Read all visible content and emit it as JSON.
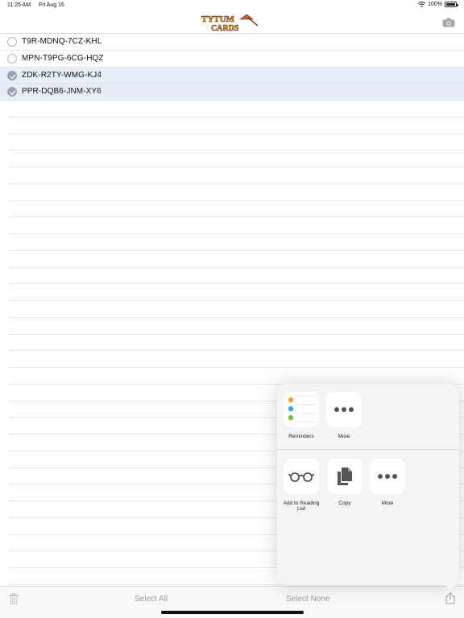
{
  "status_bar": {
    "time": "11:25 AM",
    "date": "Fri Aug 16",
    "battery_label": "100%",
    "battery_level": 1.0
  },
  "header": {
    "logo_alt": "TYTUM CARDS",
    "logo_icon": "tytum-cards-logo",
    "camera_icon": "camera-icon"
  },
  "codes": [
    {
      "code": "T9R-MDNQ-7CZ-KHL",
      "selected": false
    },
    {
      "code": "MPN-T9PG-6CG-HQZ",
      "selected": false
    },
    {
      "code": "ZDK-R2TY-WMG-KJ4",
      "selected": true
    },
    {
      "code": "PPR-DQB6-JNM-XY6",
      "selected": true
    }
  ],
  "share_sheet": {
    "top_row": [
      {
        "label": "Reminders",
        "icon": "reminders-icon"
      },
      {
        "label": "More",
        "icon": "more-icon"
      }
    ],
    "bottom_row": [
      {
        "label": "Add to Reading List",
        "icon": "reading-list-icon"
      },
      {
        "label": "Copy",
        "icon": "copy-icon"
      },
      {
        "label": "More",
        "icon": "more-icon"
      }
    ]
  },
  "toolbar": {
    "select_all": "Select All",
    "select_none": "Select None",
    "trash_icon": "trash-icon",
    "share_icon": "share-icon"
  },
  "colors": {
    "selected_row": "#e6eef8",
    "check_fill": "#9ba5ad",
    "toolbar_text": "#9a9a9a"
  }
}
